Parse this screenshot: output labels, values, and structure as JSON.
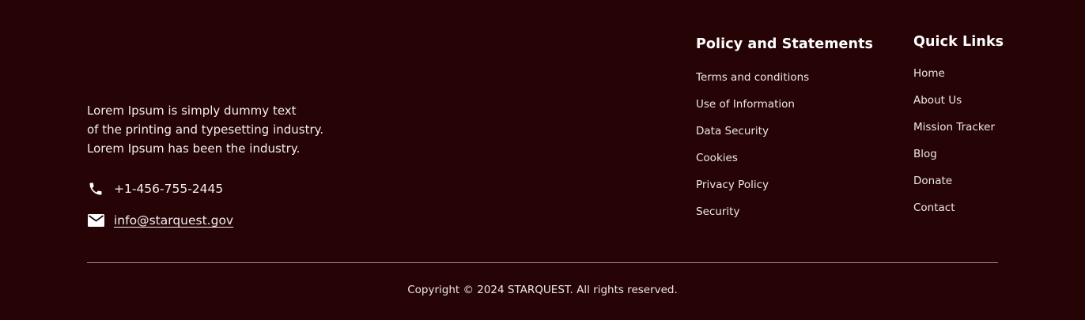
{
  "about": {
    "lines": [
      "Lorem Ipsum is simply dummy text",
      "of the printing and typesetting industry.",
      "Lorem Ipsum has been the industry."
    ]
  },
  "contact": {
    "phone": {
      "icon": "phone-icon",
      "text": "+1-456-755-2445"
    },
    "email": {
      "icon": "mail-icon",
      "text": "info@starquest.gov"
    }
  },
  "policy": {
    "title": "Policy and Statements",
    "links": [
      "Terms and conditions",
      "Use of Information",
      "Data Security",
      "Cookies",
      "Privacy Policy",
      "Security"
    ]
  },
  "quick": {
    "title": "Quick Links",
    "links": [
      "Home",
      "About Us",
      "Mission Tracker",
      "Blog",
      "Donate",
      "Contact"
    ]
  },
  "copyright": "Copyright © 2024 STARQUEST. All rights reserved.",
  "colors": {
    "background": "#260405",
    "text": "#f3eeee",
    "divider": "#9d8d8d"
  }
}
